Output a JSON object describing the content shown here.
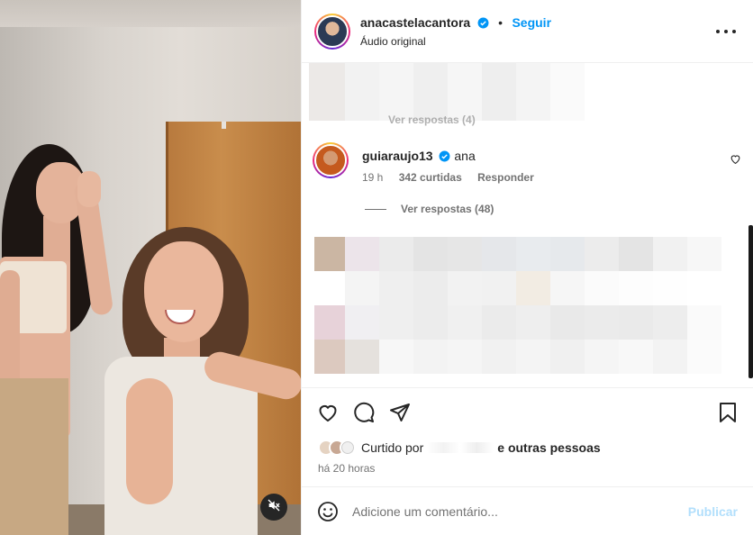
{
  "post": {
    "author": "anacastelacantora",
    "follow_label": "Seguir",
    "separator": "•",
    "audio_label": "Áudio original"
  },
  "comments": {
    "top_view_replies": "Ver respostas (4)",
    "main_comment": {
      "username": "guiaraujo13",
      "text": "ana",
      "time": "19 h",
      "likes": "342 curtidas",
      "reply_label": "Responder",
      "view_replies": "Ver respostas (48)"
    }
  },
  "actions": {
    "liked_by_prefix": "Curtido por",
    "liked_by_suffix": "e outras pessoas",
    "timestamp": "há 20 horas"
  },
  "add_comment": {
    "placeholder": "Adicione um comentário...",
    "publish_label": "Publicar"
  },
  "icons": {
    "verified": "verified-badge-icon",
    "more": "more-options-icon",
    "like": "heart-icon",
    "comment": "comment-bubble-icon",
    "share": "paper-plane-icon",
    "save": "bookmark-icon",
    "emoji": "emoji-icon",
    "mute": "muted-speaker-icon"
  },
  "colors": {
    "accent_blue": "#0095f6",
    "publish_disabled": "#b2dffc",
    "secondary_text": "#737373"
  }
}
